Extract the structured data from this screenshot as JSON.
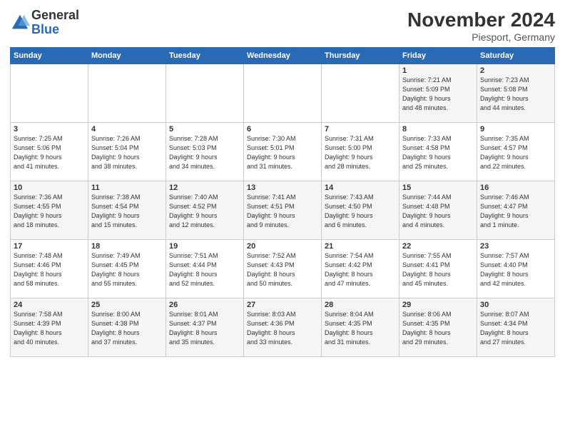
{
  "logo": {
    "general": "General",
    "blue": "Blue"
  },
  "title": "November 2024",
  "location": "Piesport, Germany",
  "headers": [
    "Sunday",
    "Monday",
    "Tuesday",
    "Wednesday",
    "Thursday",
    "Friday",
    "Saturday"
  ],
  "rows": [
    [
      {
        "day": "",
        "info": ""
      },
      {
        "day": "",
        "info": ""
      },
      {
        "day": "",
        "info": ""
      },
      {
        "day": "",
        "info": ""
      },
      {
        "day": "",
        "info": ""
      },
      {
        "day": "1",
        "info": "Sunrise: 7:21 AM\nSunset: 5:09 PM\nDaylight: 9 hours\nand 48 minutes."
      },
      {
        "day": "2",
        "info": "Sunrise: 7:23 AM\nSunset: 5:08 PM\nDaylight: 9 hours\nand 44 minutes."
      }
    ],
    [
      {
        "day": "3",
        "info": "Sunrise: 7:25 AM\nSunset: 5:06 PM\nDaylight: 9 hours\nand 41 minutes."
      },
      {
        "day": "4",
        "info": "Sunrise: 7:26 AM\nSunset: 5:04 PM\nDaylight: 9 hours\nand 38 minutes."
      },
      {
        "day": "5",
        "info": "Sunrise: 7:28 AM\nSunset: 5:03 PM\nDaylight: 9 hours\nand 34 minutes."
      },
      {
        "day": "6",
        "info": "Sunrise: 7:30 AM\nSunset: 5:01 PM\nDaylight: 9 hours\nand 31 minutes."
      },
      {
        "day": "7",
        "info": "Sunrise: 7:31 AM\nSunset: 5:00 PM\nDaylight: 9 hours\nand 28 minutes."
      },
      {
        "day": "8",
        "info": "Sunrise: 7:33 AM\nSunset: 4:58 PM\nDaylight: 9 hours\nand 25 minutes."
      },
      {
        "day": "9",
        "info": "Sunrise: 7:35 AM\nSunset: 4:57 PM\nDaylight: 9 hours\nand 22 minutes."
      }
    ],
    [
      {
        "day": "10",
        "info": "Sunrise: 7:36 AM\nSunset: 4:55 PM\nDaylight: 9 hours\nand 18 minutes."
      },
      {
        "day": "11",
        "info": "Sunrise: 7:38 AM\nSunset: 4:54 PM\nDaylight: 9 hours\nand 15 minutes."
      },
      {
        "day": "12",
        "info": "Sunrise: 7:40 AM\nSunset: 4:52 PM\nDaylight: 9 hours\nand 12 minutes."
      },
      {
        "day": "13",
        "info": "Sunrise: 7:41 AM\nSunset: 4:51 PM\nDaylight: 9 hours\nand 9 minutes."
      },
      {
        "day": "14",
        "info": "Sunrise: 7:43 AM\nSunset: 4:50 PM\nDaylight: 9 hours\nand 6 minutes."
      },
      {
        "day": "15",
        "info": "Sunrise: 7:44 AM\nSunset: 4:48 PM\nDaylight: 9 hours\nand 4 minutes."
      },
      {
        "day": "16",
        "info": "Sunrise: 7:46 AM\nSunset: 4:47 PM\nDaylight: 9 hours\nand 1 minute."
      }
    ],
    [
      {
        "day": "17",
        "info": "Sunrise: 7:48 AM\nSunset: 4:46 PM\nDaylight: 8 hours\nand 58 minutes."
      },
      {
        "day": "18",
        "info": "Sunrise: 7:49 AM\nSunset: 4:45 PM\nDaylight: 8 hours\nand 55 minutes."
      },
      {
        "day": "19",
        "info": "Sunrise: 7:51 AM\nSunset: 4:44 PM\nDaylight: 8 hours\nand 52 minutes."
      },
      {
        "day": "20",
        "info": "Sunrise: 7:52 AM\nSunset: 4:43 PM\nDaylight: 8 hours\nand 50 minutes."
      },
      {
        "day": "21",
        "info": "Sunrise: 7:54 AM\nSunset: 4:42 PM\nDaylight: 8 hours\nand 47 minutes."
      },
      {
        "day": "22",
        "info": "Sunrise: 7:55 AM\nSunset: 4:41 PM\nDaylight: 8 hours\nand 45 minutes."
      },
      {
        "day": "23",
        "info": "Sunrise: 7:57 AM\nSunset: 4:40 PM\nDaylight: 8 hours\nand 42 minutes."
      }
    ],
    [
      {
        "day": "24",
        "info": "Sunrise: 7:58 AM\nSunset: 4:39 PM\nDaylight: 8 hours\nand 40 minutes."
      },
      {
        "day": "25",
        "info": "Sunrise: 8:00 AM\nSunset: 4:38 PM\nDaylight: 8 hours\nand 37 minutes."
      },
      {
        "day": "26",
        "info": "Sunrise: 8:01 AM\nSunset: 4:37 PM\nDaylight: 8 hours\nand 35 minutes."
      },
      {
        "day": "27",
        "info": "Sunrise: 8:03 AM\nSunset: 4:36 PM\nDaylight: 8 hours\nand 33 minutes."
      },
      {
        "day": "28",
        "info": "Sunrise: 8:04 AM\nSunset: 4:35 PM\nDaylight: 8 hours\nand 31 minutes."
      },
      {
        "day": "29",
        "info": "Sunrise: 8:06 AM\nSunset: 4:35 PM\nDaylight: 8 hours\nand 29 minutes."
      },
      {
        "day": "30",
        "info": "Sunrise: 8:07 AM\nSunset: 4:34 PM\nDaylight: 8 hours\nand 27 minutes."
      }
    ]
  ]
}
